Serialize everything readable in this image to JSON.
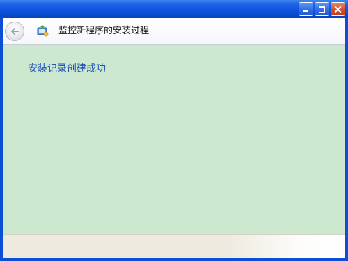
{
  "window": {
    "title": "",
    "controls": {
      "minimize_icon": "minimize-icon",
      "maximize_icon": "maximize-icon",
      "close_icon": "close-icon"
    }
  },
  "header": {
    "back_icon": "back-arrow-icon",
    "app_icon": "installer-icon",
    "title": "监控新程序的安装过程"
  },
  "content": {
    "status": "安装记录创建成功"
  },
  "colors": {
    "titlebar": "#0b50d8",
    "content_background": "#cce8cf",
    "status_text": "#1f56b8",
    "close_button": "#d2512d",
    "footer": "#eeeae0"
  }
}
